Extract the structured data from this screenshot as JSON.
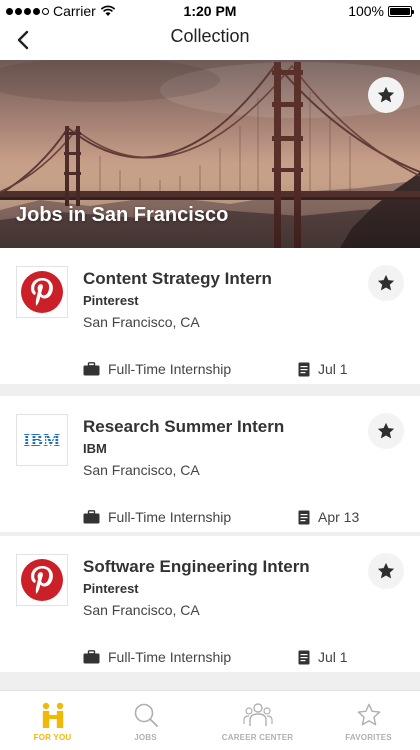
{
  "status_bar": {
    "carrier": "Carrier",
    "time": "1:20 PM",
    "battery": "100%"
  },
  "nav": {
    "title": "Collection",
    "back_icon": "chevron-left-icon"
  },
  "hero": {
    "title": "Jobs in San Francisco",
    "image": "golden-gate-bridge-sunset",
    "starred": true
  },
  "jobs": [
    {
      "title": "Content Strategy Intern",
      "company": "Pinterest",
      "location": "San Francisco, CA",
      "type": "Full-Time Internship",
      "date": "Jul 1",
      "logo": "pinterest-logo",
      "starred": true
    },
    {
      "title": "Research Summer Intern",
      "company": "IBM",
      "location": "San Francisco, CA",
      "type": "Full-Time Internship",
      "date": "Apr 13",
      "logo": "ibm-logo",
      "starred": true
    },
    {
      "title": "Software Engineering Intern",
      "company": "Pinterest",
      "location": "San Francisco, CA",
      "type": "Full-Time Internship",
      "date": "Jul 1",
      "logo": "pinterest-logo",
      "starred": true
    }
  ],
  "tabs": [
    {
      "label": "FOR YOU",
      "icon": "handshake-icon",
      "active": true
    },
    {
      "label": "JOBS",
      "icon": "search-icon",
      "active": false
    },
    {
      "label": "CAREER CENTER",
      "icon": "people-icon",
      "active": false
    },
    {
      "label": "FAVORITES",
      "icon": "star-icon",
      "active": false
    }
  ],
  "colors": {
    "accent": "#f2b807",
    "pinterest_red": "#cb2027",
    "ibm_blue": "#1f70c1",
    "icon_dark": "#2e2e2e",
    "inactive": "#b0b0b0"
  }
}
